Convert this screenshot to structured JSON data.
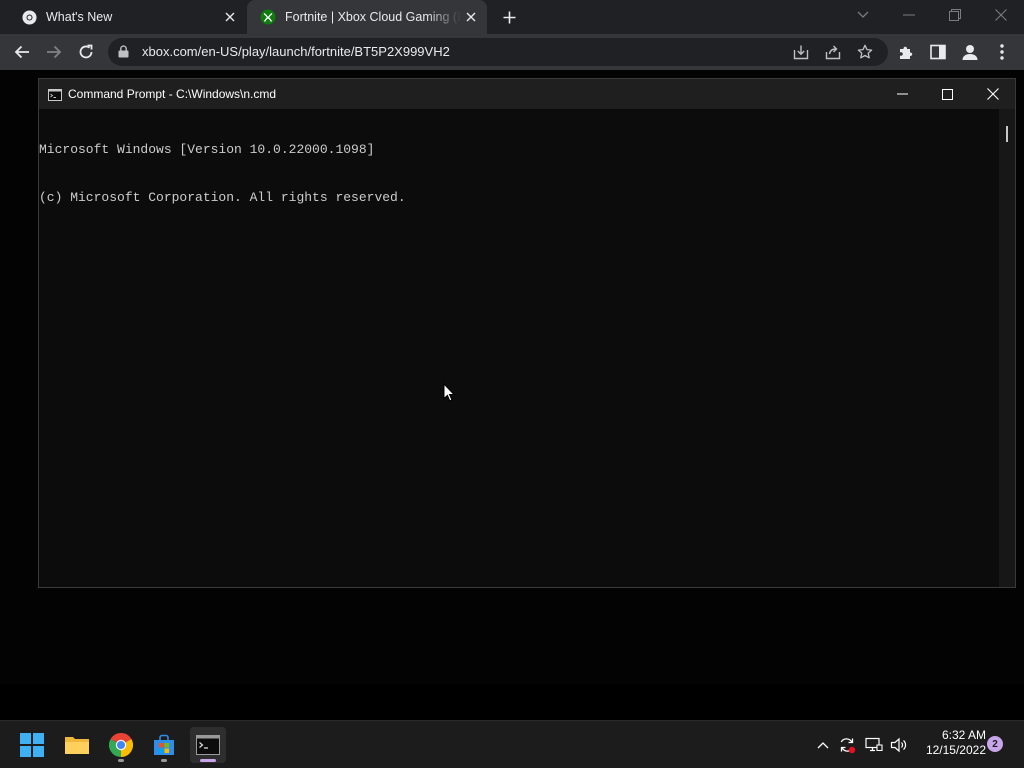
{
  "browser": {
    "tabs": [
      {
        "title": "What's New",
        "favicon": "chrome-icon",
        "active": false
      },
      {
        "title": "Fortnite | Xbox Cloud Gaming (Beta)",
        "favicon": "xbox-icon",
        "active": true
      }
    ],
    "url": "xbox.com/en-US/play/launch/fortnite/BT5P2X999VH2"
  },
  "cmd": {
    "title": "Command Prompt - C:\\Windows\\n.cmd",
    "lines": [
      "Microsoft Windows [Version 10.0.22000.1098]",
      "(c) Microsoft Corporation. All rights reserved."
    ]
  },
  "taskbar": {
    "apps": [
      "start",
      "file-explorer",
      "chrome",
      "microsoft-store",
      "command-prompt"
    ],
    "clock": {
      "time": "6:32 AM",
      "date": "12/15/2022"
    },
    "notification_count": "2"
  },
  "colors": {
    "accent": "#c8a4e8",
    "chrome_bg": "#202124",
    "chrome_toolbar": "#35363a"
  }
}
